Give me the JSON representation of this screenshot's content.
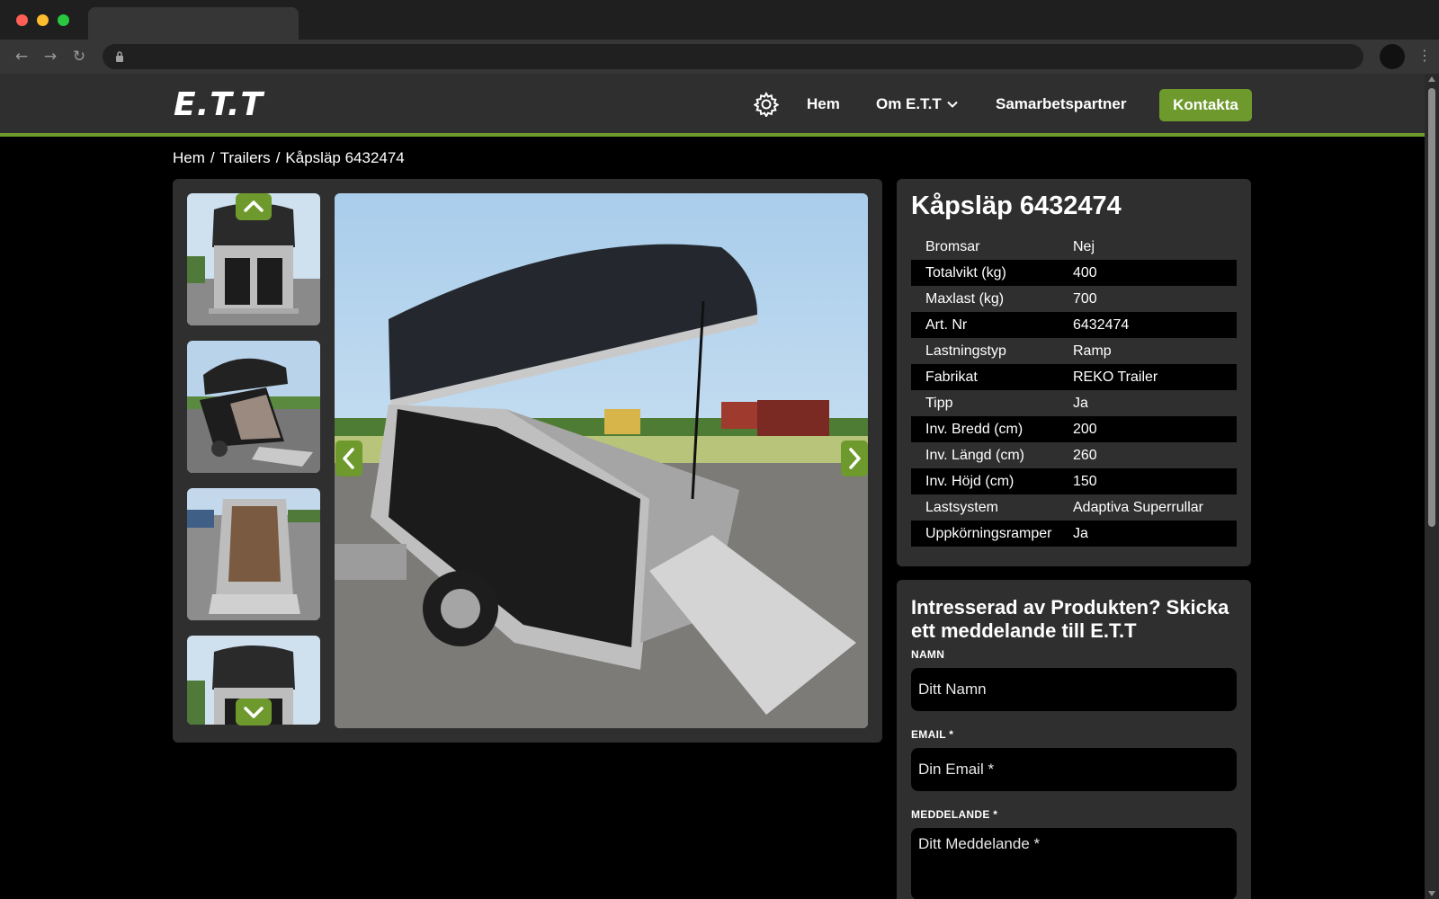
{
  "site": {
    "logo": "E.T.T",
    "nav": {
      "home": "Hem",
      "about": "Om E.T.T",
      "partner": "Samarbetspartner",
      "contact": "Kontakta"
    },
    "accent_color": "#6e9a2d"
  },
  "breadcrumb": [
    "Hem",
    "Trailers",
    "Kåpsläp 6432474"
  ],
  "breadcrumb_separator": "/",
  "gallery": {
    "thumbnail_count": 4,
    "prev_icon": "chevron-left-icon",
    "next_icon": "chevron-right-icon"
  },
  "product": {
    "title": "Kåpsläp 6432474",
    "specs": [
      {
        "label": "Bromsar",
        "value": "Nej"
      },
      {
        "label": "Totalvikt (kg)",
        "value": "400"
      },
      {
        "label": "Maxlast (kg)",
        "value": "700"
      },
      {
        "label": "Art. Nr",
        "value": "6432474"
      },
      {
        "label": "Lastningstyp",
        "value": "Ramp"
      },
      {
        "label": "Fabrikat",
        "value": "REKO Trailer"
      },
      {
        "label": "Tipp",
        "value": "Ja"
      },
      {
        "label": "Inv. Bredd (cm)",
        "value": "200"
      },
      {
        "label": "Inv. Längd (cm)",
        "value": "260"
      },
      {
        "label": "Inv. Höjd (cm)",
        "value": "150"
      },
      {
        "label": "Lastsystem",
        "value": "Adaptiva Superrullar"
      },
      {
        "label": "Uppkörningsramper",
        "value": "Ja"
      }
    ]
  },
  "form": {
    "heading": "Intresserad av Produkten? Skicka ett meddelande till E.T.T",
    "name_label": "NAMN",
    "name_placeholder": "Ditt Namn",
    "email_label": "EMAIL *",
    "email_placeholder": "Din Email *",
    "message_label": "MEDDELANDE *",
    "message_placeholder": "Ditt Meddelande *"
  }
}
